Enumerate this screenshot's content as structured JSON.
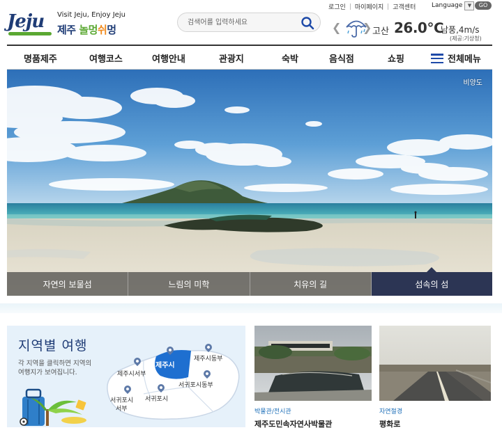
{
  "header": {
    "logo_text": "Jeju",
    "tagline": "Visit Jeju, Enjoy Jeju",
    "brand_prefix": "제주 ",
    "brand_green": "놀멍",
    "brand_orange": "쉬",
    "brand_suffix": "멍",
    "util_links": [
      "로그인",
      "마이페이지",
      "고객센터"
    ],
    "language_label": "Language",
    "go_label": "GO"
  },
  "search": {
    "placeholder": "검색어를 입력하세요"
  },
  "weather": {
    "place": "고산",
    "temperature": "26.0℃",
    "wind": "남풍,4m/s",
    "source": "(제공:기상청)",
    "icon": "umbrella-rain-icon"
  },
  "nav": {
    "items": [
      "명품제주",
      "여행코스",
      "여행안내",
      "관광지",
      "숙박",
      "음식점",
      "쇼핑"
    ],
    "all_menu": "전체메뉴"
  },
  "hero": {
    "caption": "비양도",
    "tabs": [
      "자연의 보물섬",
      "느림의 미학",
      "치유의 길",
      "섬속의 섬"
    ],
    "active_tab": 3
  },
  "region": {
    "title": "지역별 여행",
    "desc_lines": [
      "각 지역을 클릭하면 지역의",
      "여행지가 보여집니다."
    ],
    "areas": [
      "제주시",
      "제주시동부",
      "제주시서부",
      "서귀포시동부",
      "서귀포시",
      "서귀포시",
      "서부"
    ],
    "selected": "제주시"
  },
  "cards": [
    {
      "category": "박물관/전시관",
      "title": "제주도민속자연사박물관"
    },
    {
      "category": "자연절경",
      "title": "평화로"
    }
  ],
  "colors": {
    "brand_navy": "#1f3c76",
    "brand_green": "#5aa832",
    "accent_blue": "#1e4aa8",
    "active_tab": "#2c3554"
  }
}
